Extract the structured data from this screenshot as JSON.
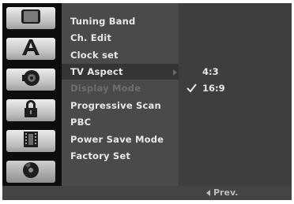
{
  "sidebar": {
    "tabs": [
      {
        "icon": "tv-icon",
        "active": false
      },
      {
        "icon": "language-letter-icon",
        "active": false
      },
      {
        "icon": "speaker-icon",
        "active": false
      },
      {
        "icon": "lock-icon",
        "active": false
      },
      {
        "icon": "film-icon",
        "active": false
      },
      {
        "icon": "disc-icon",
        "active": false
      }
    ]
  },
  "menu": {
    "items": [
      {
        "label": "Tuning Band",
        "state": "normal"
      },
      {
        "label": "Ch. Edit",
        "state": "normal"
      },
      {
        "label": "Clock set",
        "state": "normal"
      },
      {
        "label": "TV Aspect",
        "state": "selected"
      },
      {
        "label": "Display Mode",
        "state": "disabled"
      },
      {
        "label": "Progressive Scan",
        "state": "normal"
      },
      {
        "label": "PBC",
        "state": "normal"
      },
      {
        "label": "Power Save Mode",
        "state": "normal"
      },
      {
        "label": "Factory Set",
        "state": "normal"
      }
    ]
  },
  "submenu": {
    "options": [
      {
        "label": "4:3",
        "checked": false
      },
      {
        "label": "16:9",
        "checked": true
      }
    ]
  },
  "footer": {
    "prev_label": "Prev."
  },
  "colors": {
    "background": "#2b2b2b",
    "menu_panel": "#4a4a4a",
    "text": "#e8e8e8",
    "disabled_text": "#6e6e6e"
  }
}
